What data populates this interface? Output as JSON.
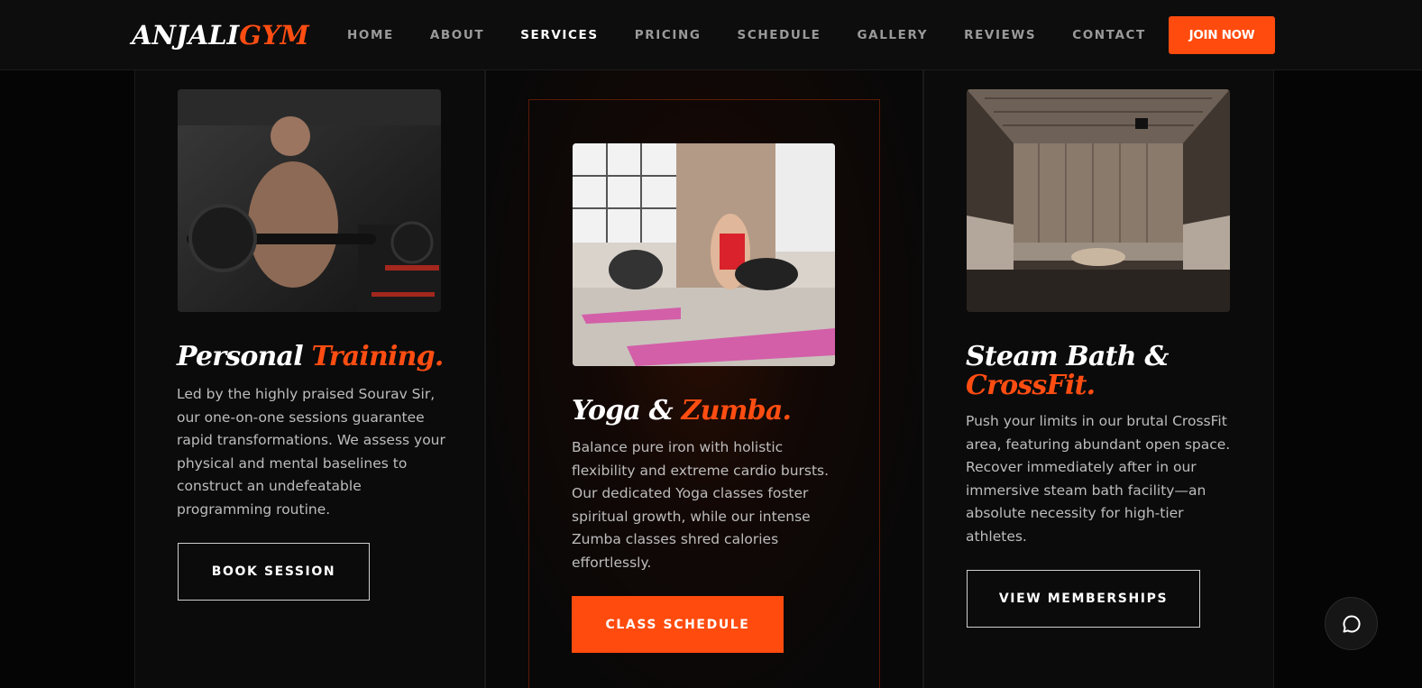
{
  "brand": {
    "part1": "ANJALI",
    "part2": "GYM"
  },
  "nav": {
    "items": [
      "HOME",
      "ABOUT",
      "SERVICES",
      "PRICING",
      "SCHEDULE",
      "GALLERY",
      "REVIEWS",
      "CONTACT"
    ],
    "active": "SERVICES",
    "cta": "JOIN NOW"
  },
  "services": [
    {
      "title_plain": "Personal ",
      "title_accent": "Training.",
      "image": "man-lifting-barbell-photo",
      "description": "Led by the highly praised Sourav Sir, our one-on-one sessions guarantee rapid transformations. We assess your physical and mental baselines to construct an undefeatable programming routine.",
      "button": "BOOK SESSION"
    },
    {
      "title_plain": "Yoga & ",
      "title_accent": "Zumba.",
      "image": "women-yoga-class-photo",
      "description": "Balance pure iron with holistic flexibility and extreme cardio bursts. Our dedicated Yoga classes foster spiritual growth, while our intense Zumba classes shred calories effortlessly.",
      "button": "CLASS SCHEDULE"
    },
    {
      "title_plain": "Steam Bath & ",
      "title_accent": "CrossFit.",
      "image": "steam-sauna-room-photo",
      "description": "Push your limits in our brutal CrossFit area, featuring abundant open space. Recover immediately after in our immersive steam bath facility—an absolute necessity for high-tier athletes.",
      "button": "VIEW MEMBERSHIPS"
    }
  ],
  "colors": {
    "accent": "#ff4b0e",
    "background": "#050505",
    "nav_bg": "#0d0d0d"
  },
  "chat_icon": "chat-bubble-icon"
}
